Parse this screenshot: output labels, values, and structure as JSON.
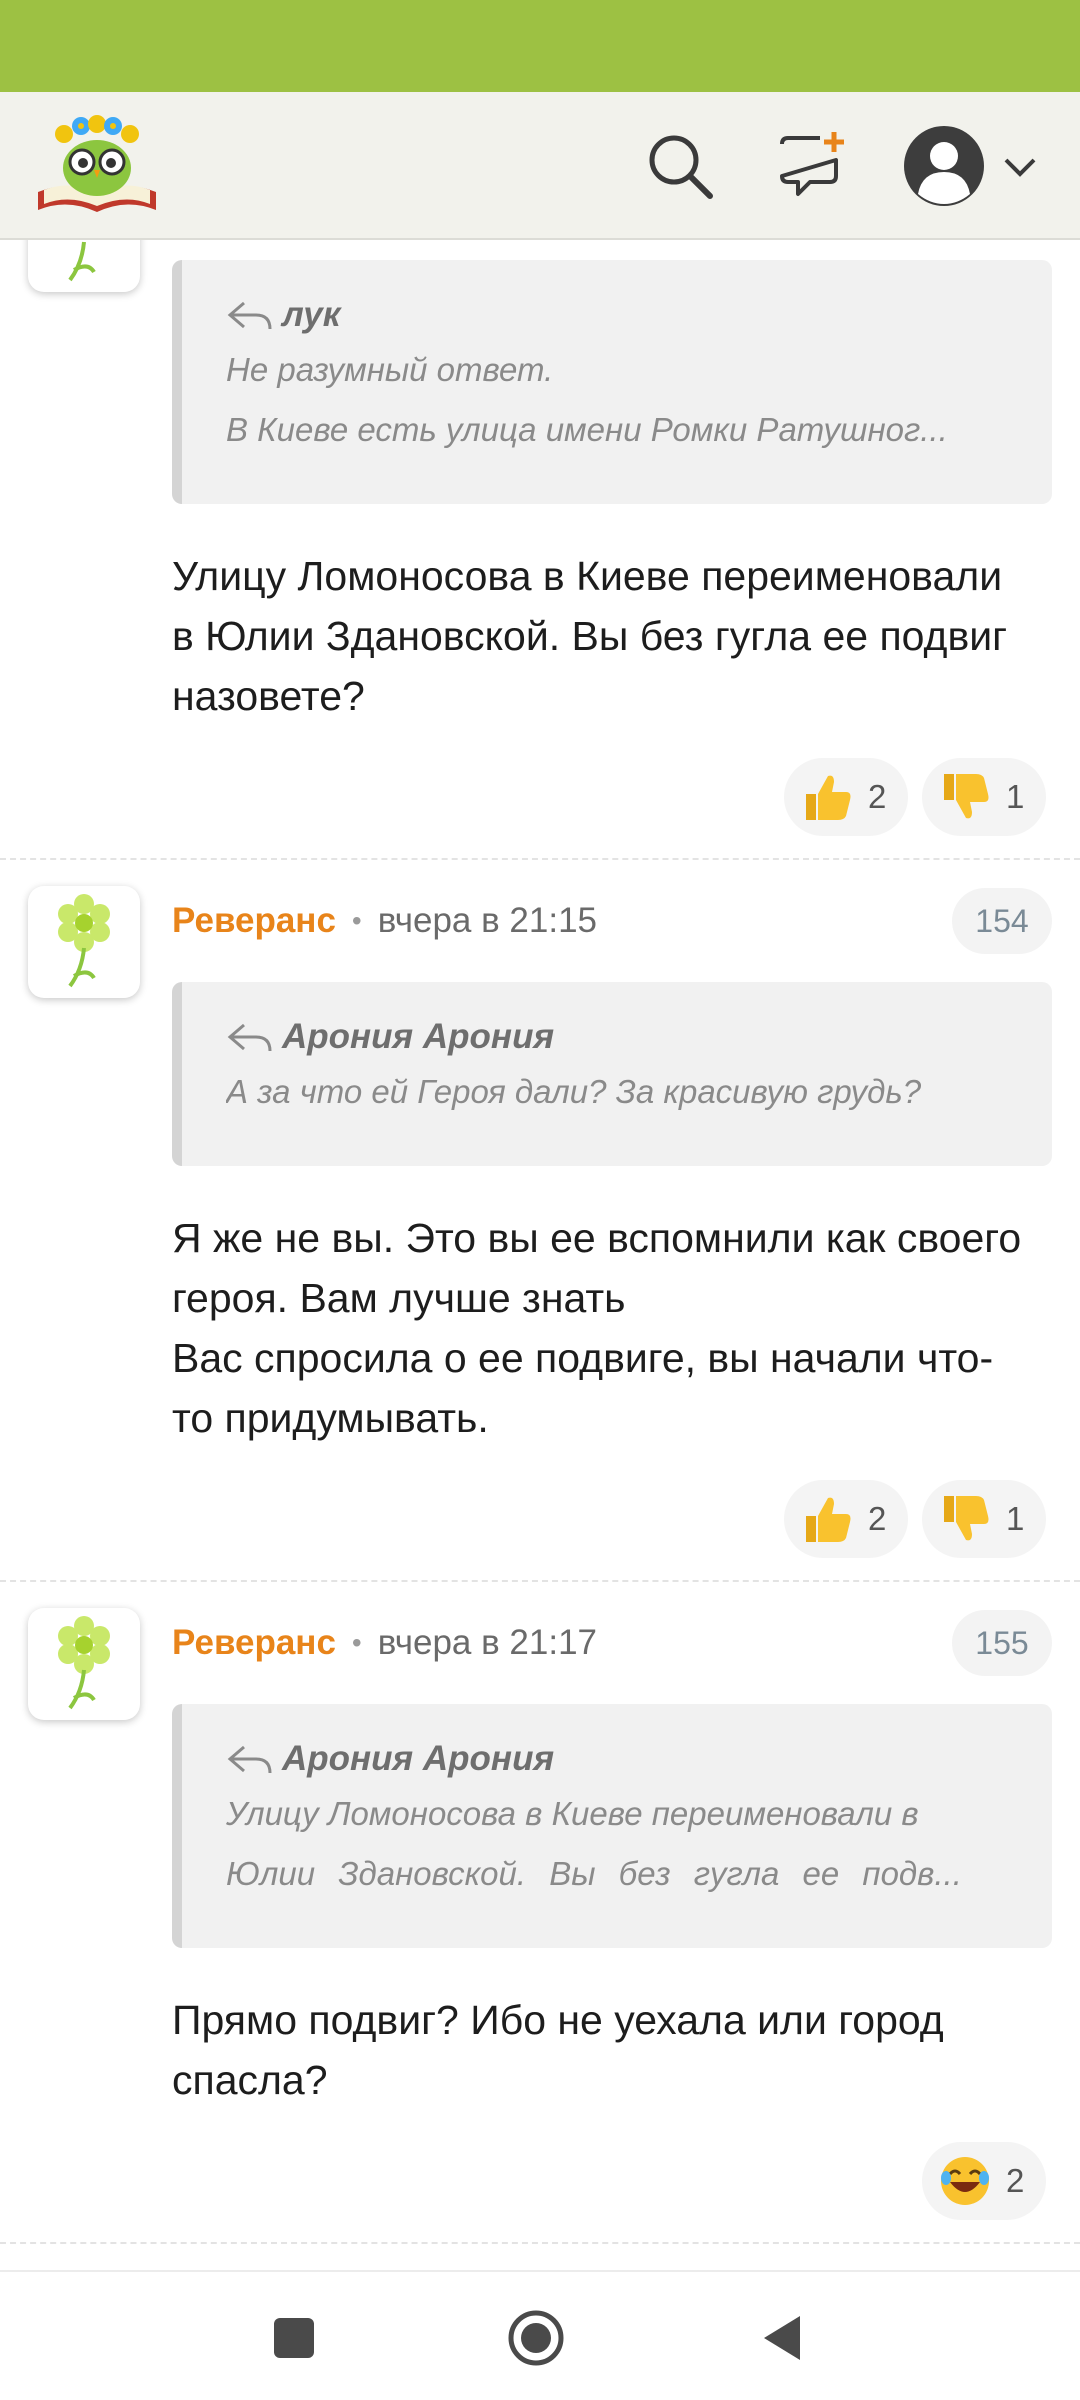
{
  "colors": {
    "status_bar": "#9dc143",
    "accent_author": "#e8841a",
    "header_bg": "#f2f2ec"
  },
  "header": {
    "logo_icon": "owl-with-book-logo",
    "icons": [
      "search-icon",
      "new-message-icon",
      "user-avatar-icon",
      "chevron-down-icon"
    ]
  },
  "feed": {
    "partial_comment": {
      "quote": {
        "author": "лук",
        "lines": [
          "Не разумный ответ.",
          "В Киеве есть улица имени Ромки Ратушног..."
        ]
      },
      "text": "Улицу Ломоносова в Киеве переименовали в Юлии Здановской. Вы без гугла ее подвиг назовете?",
      "likes": "2",
      "dislikes": "1"
    },
    "comments": [
      {
        "author": "Реверанс",
        "time": "вчера в 21:15",
        "number": "154",
        "quote": {
          "author": "Арония Арония",
          "lines": [
            "А за что ей Героя дали? За красивую грудь?"
          ]
        },
        "text": "Я же не вы. Это вы ее вспомнили как своего героя. Вам лучше знать\nВас спросила о ее подвиге, вы начали что-то придумывать.",
        "likes": "2",
        "dislikes": "1"
      },
      {
        "author": "Реверанс",
        "time": "вчера в 21:17",
        "number": "155",
        "quote": {
          "author": "Арония Арония",
          "lines": [
            "Улицу Ломоносова в Киеве переименовали в",
            "Юлии Здановской. Вы без гугла ее подв..."
          ]
        },
        "text": "Прямо подвиг? Ибо не уехала или город спасла?",
        "laughs": "2"
      }
    ]
  },
  "nav": {
    "icons": [
      "recents-square-icon",
      "home-circle-icon",
      "back-triangle-icon"
    ]
  }
}
